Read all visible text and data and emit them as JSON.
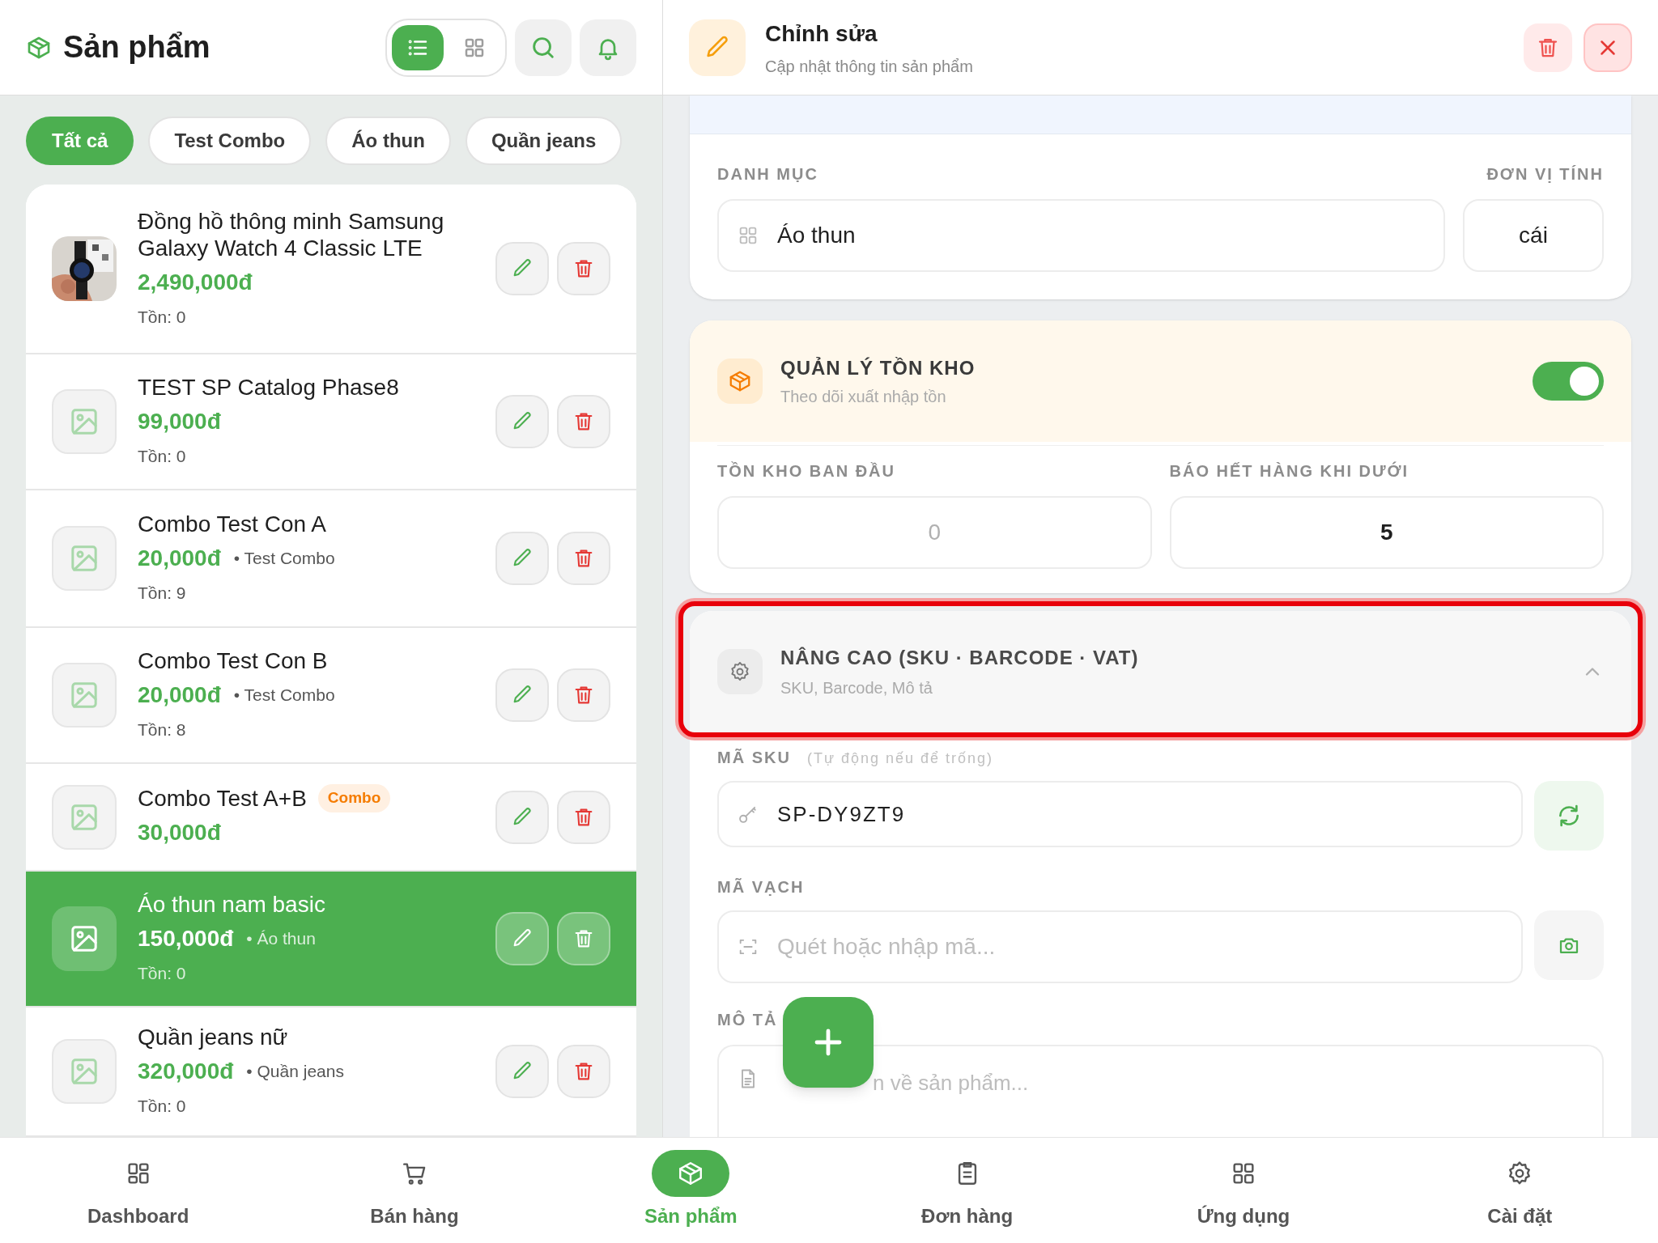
{
  "header": {
    "title": "Sản phẩm",
    "view_modes": [
      {
        "kind": "list",
        "selected": true
      },
      {
        "kind": "grid",
        "selected": false
      }
    ]
  },
  "filters": [
    {
      "label": "Tất cả",
      "selected": true
    },
    {
      "label": "Test Combo",
      "selected": false
    },
    {
      "label": "Áo thun",
      "selected": false
    },
    {
      "label": "Quần jeans",
      "selected": false
    }
  ],
  "products": [
    {
      "name": "Đồng hồ thông minh Samsung Galaxy Watch 4 Classic LTE",
      "price": "2,490,000đ",
      "stock": "Tồn: 0",
      "selected": false
    },
    {
      "name": "TEST SP Catalog Phase8",
      "price": "99,000đ",
      "stock": "Tồn: 0",
      "kind": "placeholder",
      "selected": false
    },
    {
      "name": "Combo Test Con A",
      "price": "20,000đ",
      "category": "• Test Combo",
      "stock": "Tồn: 9",
      "kind": "placeholder",
      "selected": false
    },
    {
      "name": "Combo Test Con B",
      "price": "20,000đ",
      "category": "• Test Combo",
      "stock": "Tồn: 8",
      "kind": "placeholder",
      "selected": false
    },
    {
      "name": "Combo Test A+B",
      "badge": "Combo",
      "price": "30,000đ",
      "kind": "placeholder",
      "selected": false
    },
    {
      "name": "Áo thun nam basic",
      "price": "150,000đ",
      "category": "• Áo thun",
      "stock": "Tồn: 0",
      "kind": "placeholder",
      "selected": true
    },
    {
      "name": "Quần jeans nữ",
      "price": "320,000đ",
      "category": "• Quần jeans",
      "stock": "Tồn: 0",
      "kind": "placeholder",
      "selected": false
    }
  ],
  "editor": {
    "title": "Chỉnh sửa",
    "subtitle": "Cập nhật thông tin sản phẩm",
    "category_label": "DANH MỤC",
    "category_value": "Áo thun",
    "unit_label": "ĐƠN VỊ TÍNH",
    "unit_value": "cái",
    "inventory": {
      "title": "QUẢN LÝ TỒN KHO",
      "subtitle": "Theo dõi xuất nhập tồn",
      "on": true,
      "initial_label": "TỒN KHO BAN ĐẦU",
      "initial_placeholder": "0",
      "threshold_label": "BÁO HẾT HÀNG KHI DƯỚI",
      "threshold_value": "5"
    },
    "advanced": {
      "title": "NÂNG CAO (SKU · BARCODE · VAT)",
      "subtitle": "SKU, Barcode, Mô tả",
      "expanded": true,
      "highlighted": true
    },
    "sku_label": "MÃ SKU",
    "sku_hint": "(Tự động nếu để trống)",
    "sku_value": "SP-DY9ZT9",
    "barcode_label": "MÃ VẠCH",
    "barcode_placeholder": "Quét hoặc nhập mã...",
    "description_label": "MÔ TẢ",
    "description_placeholder": "n về sản phẩm..."
  },
  "nav": [
    {
      "label": "Dashboard",
      "kind": "dashboard",
      "selected": false
    },
    {
      "label": "Bán hàng",
      "kind": "cart",
      "selected": false
    },
    {
      "label": "Sản phẩm",
      "kind": "box",
      "selected": true
    },
    {
      "label": "Đơn hàng",
      "kind": "orders",
      "selected": false
    },
    {
      "label": "Ứng dụng",
      "kind": "apps",
      "selected": false
    },
    {
      "label": "Cài đặt",
      "kind": "settings",
      "selected": false
    }
  ]
}
